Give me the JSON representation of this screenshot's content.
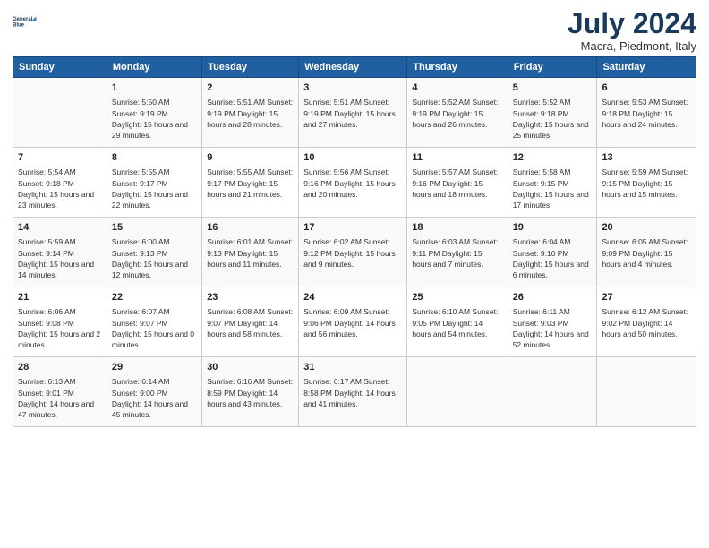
{
  "header": {
    "logo_line1": "General",
    "logo_line2": "Blue",
    "month_year": "July 2024",
    "location": "Macra, Piedmont, Italy"
  },
  "days_of_week": [
    "Sunday",
    "Monday",
    "Tuesday",
    "Wednesday",
    "Thursday",
    "Friday",
    "Saturday"
  ],
  "weeks": [
    [
      {
        "day": "",
        "info": ""
      },
      {
        "day": "1",
        "info": "Sunrise: 5:50 AM\nSunset: 9:19 PM\nDaylight: 15 hours\nand 29 minutes."
      },
      {
        "day": "2",
        "info": "Sunrise: 5:51 AM\nSunset: 9:19 PM\nDaylight: 15 hours\nand 28 minutes."
      },
      {
        "day": "3",
        "info": "Sunrise: 5:51 AM\nSunset: 9:19 PM\nDaylight: 15 hours\nand 27 minutes."
      },
      {
        "day": "4",
        "info": "Sunrise: 5:52 AM\nSunset: 9:19 PM\nDaylight: 15 hours\nand 26 minutes."
      },
      {
        "day": "5",
        "info": "Sunrise: 5:52 AM\nSunset: 9:18 PM\nDaylight: 15 hours\nand 25 minutes."
      },
      {
        "day": "6",
        "info": "Sunrise: 5:53 AM\nSunset: 9:18 PM\nDaylight: 15 hours\nand 24 minutes."
      }
    ],
    [
      {
        "day": "7",
        "info": "Sunrise: 5:54 AM\nSunset: 9:18 PM\nDaylight: 15 hours\nand 23 minutes."
      },
      {
        "day": "8",
        "info": "Sunrise: 5:55 AM\nSunset: 9:17 PM\nDaylight: 15 hours\nand 22 minutes."
      },
      {
        "day": "9",
        "info": "Sunrise: 5:55 AM\nSunset: 9:17 PM\nDaylight: 15 hours\nand 21 minutes."
      },
      {
        "day": "10",
        "info": "Sunrise: 5:56 AM\nSunset: 9:16 PM\nDaylight: 15 hours\nand 20 minutes."
      },
      {
        "day": "11",
        "info": "Sunrise: 5:57 AM\nSunset: 9:16 PM\nDaylight: 15 hours\nand 18 minutes."
      },
      {
        "day": "12",
        "info": "Sunrise: 5:58 AM\nSunset: 9:15 PM\nDaylight: 15 hours\nand 17 minutes."
      },
      {
        "day": "13",
        "info": "Sunrise: 5:59 AM\nSunset: 9:15 PM\nDaylight: 15 hours\nand 15 minutes."
      }
    ],
    [
      {
        "day": "14",
        "info": "Sunrise: 5:59 AM\nSunset: 9:14 PM\nDaylight: 15 hours\nand 14 minutes."
      },
      {
        "day": "15",
        "info": "Sunrise: 6:00 AM\nSunset: 9:13 PM\nDaylight: 15 hours\nand 12 minutes."
      },
      {
        "day": "16",
        "info": "Sunrise: 6:01 AM\nSunset: 9:13 PM\nDaylight: 15 hours\nand 11 minutes."
      },
      {
        "day": "17",
        "info": "Sunrise: 6:02 AM\nSunset: 9:12 PM\nDaylight: 15 hours\nand 9 minutes."
      },
      {
        "day": "18",
        "info": "Sunrise: 6:03 AM\nSunset: 9:11 PM\nDaylight: 15 hours\nand 7 minutes."
      },
      {
        "day": "19",
        "info": "Sunrise: 6:04 AM\nSunset: 9:10 PM\nDaylight: 15 hours\nand 6 minutes."
      },
      {
        "day": "20",
        "info": "Sunrise: 6:05 AM\nSunset: 9:09 PM\nDaylight: 15 hours\nand 4 minutes."
      }
    ],
    [
      {
        "day": "21",
        "info": "Sunrise: 6:06 AM\nSunset: 9:08 PM\nDaylight: 15 hours\nand 2 minutes."
      },
      {
        "day": "22",
        "info": "Sunrise: 6:07 AM\nSunset: 9:07 PM\nDaylight: 15 hours\nand 0 minutes."
      },
      {
        "day": "23",
        "info": "Sunrise: 6:08 AM\nSunset: 9:07 PM\nDaylight: 14 hours\nand 58 minutes."
      },
      {
        "day": "24",
        "info": "Sunrise: 6:09 AM\nSunset: 9:06 PM\nDaylight: 14 hours\nand 56 minutes."
      },
      {
        "day": "25",
        "info": "Sunrise: 6:10 AM\nSunset: 9:05 PM\nDaylight: 14 hours\nand 54 minutes."
      },
      {
        "day": "26",
        "info": "Sunrise: 6:11 AM\nSunset: 9:03 PM\nDaylight: 14 hours\nand 52 minutes."
      },
      {
        "day": "27",
        "info": "Sunrise: 6:12 AM\nSunset: 9:02 PM\nDaylight: 14 hours\nand 50 minutes."
      }
    ],
    [
      {
        "day": "28",
        "info": "Sunrise: 6:13 AM\nSunset: 9:01 PM\nDaylight: 14 hours\nand 47 minutes."
      },
      {
        "day": "29",
        "info": "Sunrise: 6:14 AM\nSunset: 9:00 PM\nDaylight: 14 hours\nand 45 minutes."
      },
      {
        "day": "30",
        "info": "Sunrise: 6:16 AM\nSunset: 8:59 PM\nDaylight: 14 hours\nand 43 minutes."
      },
      {
        "day": "31",
        "info": "Sunrise: 6:17 AM\nSunset: 8:58 PM\nDaylight: 14 hours\nand 41 minutes."
      },
      {
        "day": "",
        "info": ""
      },
      {
        "day": "",
        "info": ""
      },
      {
        "day": "",
        "info": ""
      }
    ]
  ]
}
